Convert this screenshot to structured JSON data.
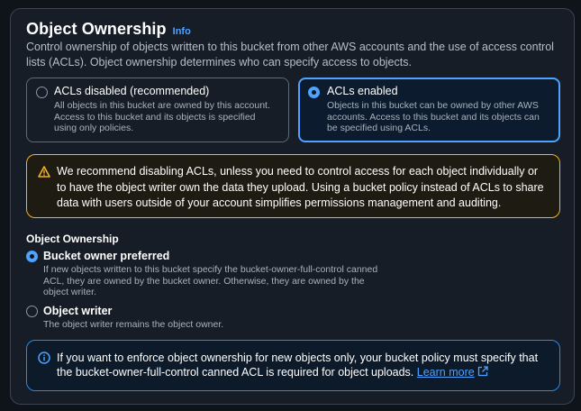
{
  "section": {
    "title": "Object Ownership",
    "info_label": "Info",
    "description": "Control ownership of objects written to this bucket from other AWS accounts and the use of access control lists (ACLs). Object ownership determines who can specify access to objects."
  },
  "tiles": [
    {
      "label": "ACLs disabled (recommended)",
      "description": "All objects in this bucket are owned by this account. Access to this bucket and its objects is specified using only policies.",
      "selected": false
    },
    {
      "label": "ACLs enabled",
      "description": "Objects in this bucket can be owned by other AWS accounts. Access to this bucket and its objects can be specified using ACLs.",
      "selected": true
    }
  ],
  "warning": {
    "text": "We recommend disabling ACLs, unless you need to control access for each object individually or to have the object writer own the data they upload. Using a bucket policy instead of ACLs to share data with users outside of your account simplifies permissions management and auditing.",
    "icon": "warning-icon"
  },
  "ownership": {
    "label": "Object Ownership",
    "options": [
      {
        "label": "Bucket owner preferred",
        "description": "If new objects written to this bucket specify the bucket-owner-full-control canned ACL, they are owned by the bucket owner. Otherwise, they are owned by the object writer.",
        "selected": true
      },
      {
        "label": "Object writer",
        "description": "The object writer remains the object owner.",
        "selected": false
      }
    ]
  },
  "note": {
    "text": "If you want to enforce object ownership for new objects only, your bucket policy must specify that the bucket-owner-full-control canned ACL is required for object uploads.",
    "link_label": "Learn more",
    "icon": "info-icon"
  },
  "colors": {
    "accent": "#4da3ff",
    "warning": "#f2b229",
    "background": "#0f141a"
  }
}
